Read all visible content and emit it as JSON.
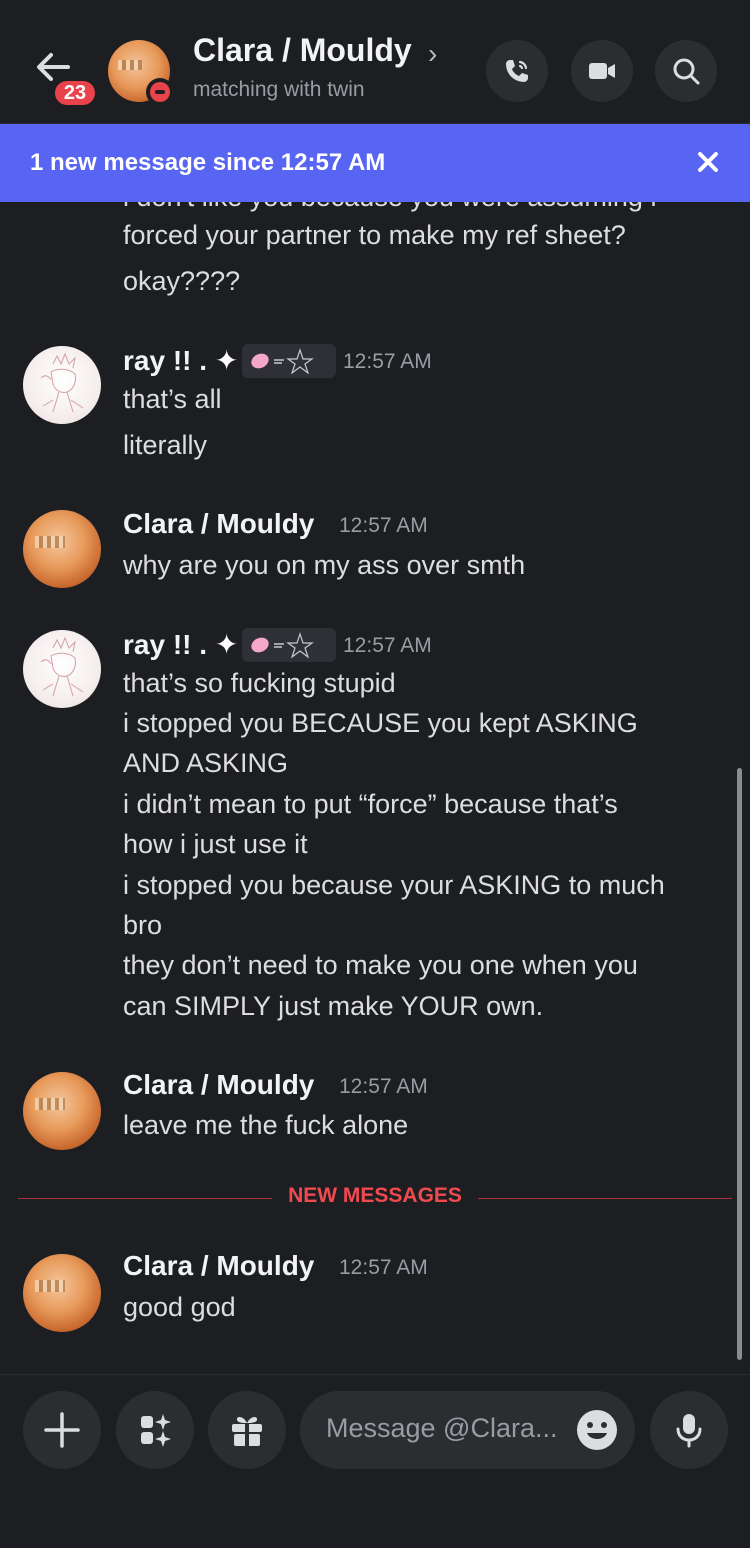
{
  "header": {
    "unread_badge": "23",
    "title": "Clara / Mouldy",
    "title_chevron": "›",
    "subtitle": "matching with twin"
  },
  "banner": {
    "text": "1 new message since 12:57 AM",
    "accent": "#5865f2"
  },
  "messages": {
    "cutoff_top": "i don't like you because you were assuming i",
    "continued": [
      "forced your partner to make my ref sheet?",
      "okay????"
    ],
    "groups": [
      {
        "author": "ray !! .",
        "sparkle": "✦",
        "time": "12:57 AM",
        "lines": [
          "that’s all",
          "literally"
        ]
      },
      {
        "author": "Clara / Mouldy",
        "time": "12:57 AM",
        "lines": [
          "why are you on my ass over smth"
        ]
      },
      {
        "author": "ray !! .",
        "sparkle": "✦",
        "time": "12:57 AM",
        "lines": [
          "that’s so fucking stupid",
          "i stopped you BECAUSE you kept ASKING",
          "AND ASKING",
          "i didn’t mean to put “force” because that’s",
          "how i just use it",
          "i stopped you because your ASKING to much",
          "bro",
          "they don’t need to make you one when you",
          "can SIMPLY just make YOUR own."
        ]
      },
      {
        "author": "Clara / Mouldy",
        "time": "12:57 AM",
        "lines": [
          "leave me the fuck alone"
        ]
      },
      {
        "author": "Clara / Mouldy",
        "time": "12:57 AM",
        "lines": [
          "good god"
        ]
      }
    ],
    "new_divider": "NEW MESSAGES"
  },
  "composer": {
    "placeholder": "Message @Clara..."
  },
  "colors": {
    "background": "#1d1e22",
    "danger": "#f04a50",
    "surface": "#2b2d31"
  }
}
